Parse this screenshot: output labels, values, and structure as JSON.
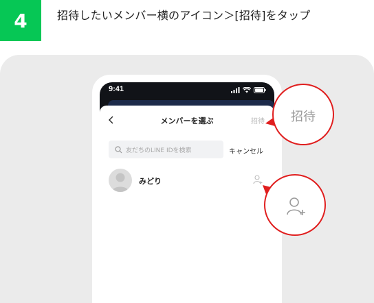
{
  "step": {
    "number": "4",
    "instruction": "招待したいメンバー横のアイコン＞[招待]をタップ",
    "accent": "#06c755"
  },
  "status_bar": {
    "time": "9:41"
  },
  "header": {
    "title": "メンバーを選ぶ",
    "invite_label": "招待",
    "back_icon": "chevron-left-icon"
  },
  "search": {
    "placeholder": "友だちのLINE IDを検索",
    "cancel_label": "キャンセル",
    "icon": "search-icon"
  },
  "members": [
    {
      "name": "みどり",
      "action_icon": "add-person-icon"
    }
  ],
  "callouts": {
    "invite_label": "招待",
    "add_icon": "add-person-icon",
    "ring_color": "#e01e1e"
  }
}
